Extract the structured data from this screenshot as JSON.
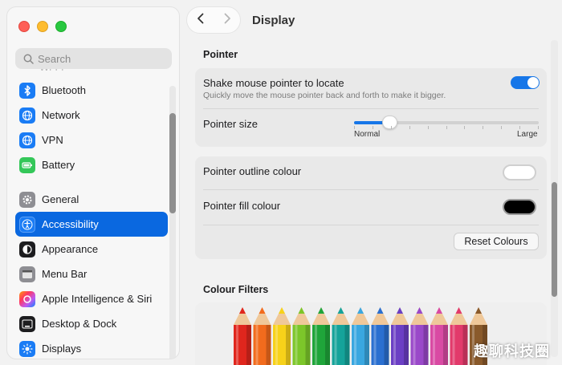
{
  "sidebar": {
    "search_placeholder": "Search",
    "ghost_item": "Wi-Fi",
    "items": [
      {
        "label": "Bluetooth",
        "icon": "bluetooth-icon",
        "color": "#1a7cf5"
      },
      {
        "label": "Network",
        "icon": "globe-icon",
        "color": "#1a7cf5"
      },
      {
        "label": "VPN",
        "icon": "vpn-globe-icon",
        "color": "#1a7cf5"
      },
      {
        "label": "Battery",
        "icon": "battery-icon",
        "color": "#34c759"
      },
      {
        "label": "General",
        "icon": "gear-icon",
        "color": "#8e8e93"
      },
      {
        "label": "Accessibility",
        "icon": "accessibility-icon",
        "color": "#1a7cf5"
      },
      {
        "label": "Appearance",
        "icon": "appearance-icon",
        "color": "#1d1d1f"
      },
      {
        "label": "Menu Bar",
        "icon": "menu-bar-icon",
        "color": "#8e8e93"
      },
      {
        "label": "Apple Intelligence & Siri",
        "icon": "siri-icon",
        "color": "#ff7a59"
      },
      {
        "label": "Desktop & Dock",
        "icon": "desktop-dock-icon",
        "color": "#1d1d1f"
      },
      {
        "label": "Displays",
        "icon": "displays-icon",
        "color": "#1a7cf5"
      }
    ]
  },
  "header": {
    "title": "Display"
  },
  "pointer": {
    "section_title": "Pointer",
    "shake_title": "Shake mouse pointer to locate",
    "shake_subtitle": "Quickly move the mouse pointer back and forth to make it bigger.",
    "shake_enabled": true,
    "size_title": "Pointer size",
    "size_min_label": "Normal",
    "size_max_label": "Large",
    "size_value": 0.19,
    "outline_title": "Pointer outline colour",
    "outline_color": "#ffffff",
    "fill_title": "Pointer fill colour",
    "fill_color": "#000000",
    "reset_label": "Reset Colours"
  },
  "filters": {
    "section_title": "Colour Filters",
    "pencil_colors": [
      "#e0261d",
      "#f26b1d",
      "#f7d21a",
      "#7cc62a",
      "#1fa53a",
      "#15a39a",
      "#3aa7e0",
      "#2a6fd0",
      "#6b3fc4",
      "#9a49c9",
      "#d94aa3",
      "#e23a6b",
      "#8a5a2b"
    ]
  },
  "watermark": "趣聊科技圈",
  "colors": {
    "accent": "#0a68e0",
    "toggle_on": "#1676e8"
  }
}
